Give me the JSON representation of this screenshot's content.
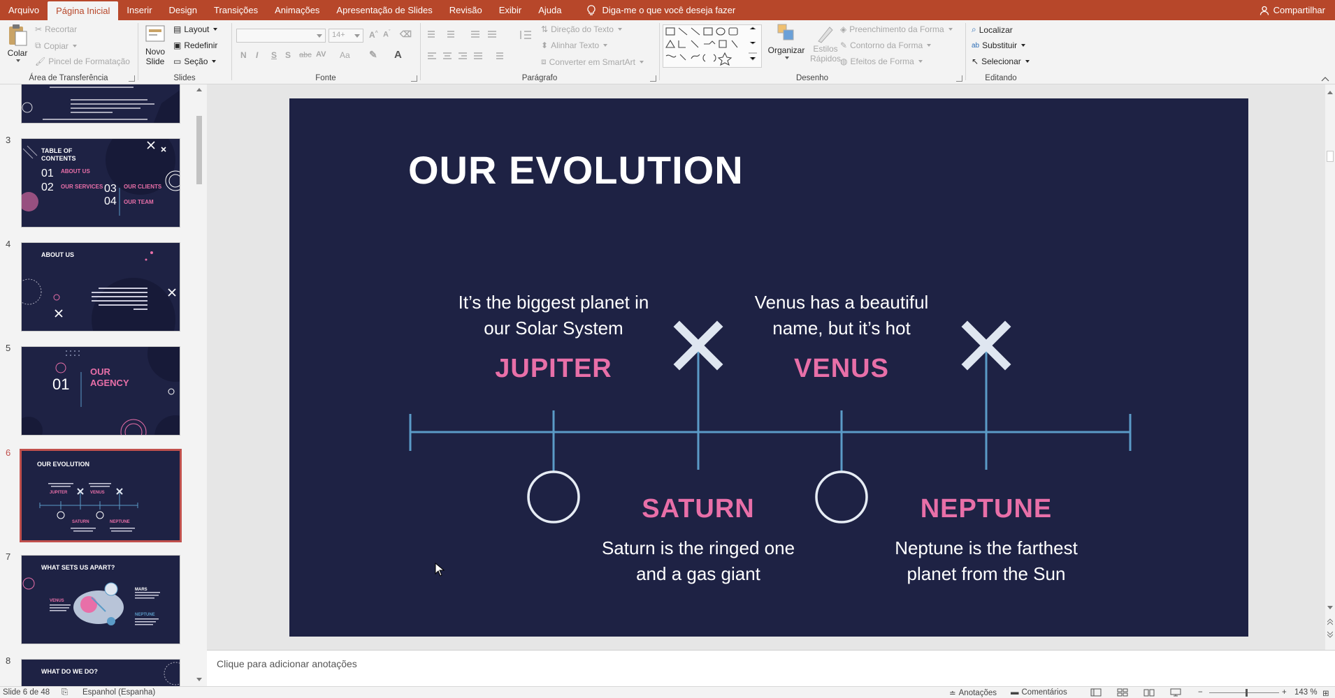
{
  "app": {
    "menu_tabs": [
      "Arquivo",
      "Página Inicial",
      "Inserir",
      "Design",
      "Transições",
      "Animações",
      "Apresentação de Slides",
      "Revisão",
      "Exibir",
      "Ajuda"
    ],
    "active_tab": "Página Inicial",
    "tell_me": "Diga-me o que você deseja fazer",
    "share": "Compartilhar",
    "accent": "#b7472a"
  },
  "ribbon": {
    "clipboard": {
      "paste": "Colar",
      "cut": "Recortar",
      "copy": "Copiar",
      "format_painter": "Pincel de Formatação",
      "label": "Área de Transferência"
    },
    "slides": {
      "new_slide_1": "Novo",
      "new_slide_2": "Slide",
      "layout": "Layout",
      "reset": "Redefinir",
      "section": "Seção",
      "label": "Slides"
    },
    "font": {
      "size": "14+",
      "bold": "N",
      "italic": "I",
      "underline": "S",
      "shadow": "S",
      "strike": "abc",
      "spacing": "AV",
      "case": "Aa",
      "label": "Fonte"
    },
    "paragraph": {
      "direction": "Direção do Texto",
      "align": "Alinhar Texto",
      "smartart": "Converter em SmartArt",
      "label": "Parágrafo"
    },
    "drawing": {
      "arrange": "Organizar",
      "styles_1": "Estilos",
      "styles_2": "Rápidos",
      "fill": "Preenchimento da Forma",
      "outline": "Contorno da Forma",
      "effects": "Efeitos de Forma",
      "label": "Desenho"
    },
    "editing": {
      "find": "Localizar",
      "replace": "Substituir",
      "select": "Selecionar",
      "label": "Editando"
    }
  },
  "thumbnails": {
    "slide3": {
      "num": "3",
      "title_1": "TABLE OF",
      "title_2": "CONTENTS",
      "n1": "01",
      "n2": "02",
      "n3": "03",
      "n4": "04",
      "s1": "ABOUT US",
      "s2": "OUR SERVICES",
      "s3": "OUR CLIENTS",
      "s4": "OUR TEAM"
    },
    "slide4": {
      "num": "4",
      "title": "ABOUT US"
    },
    "slide5": {
      "num": "5",
      "title_1": "OUR",
      "title_2": "AGENCY",
      "n": "01"
    },
    "slide6": {
      "num": "6",
      "title": "OUR EVOLUTION",
      "p1": "JUPITER",
      "p2": "VENUS",
      "p3": "SATURN",
      "p4": "NEPTUNE"
    },
    "slide7": {
      "num": "7",
      "title": "WHAT SETS US APART?",
      "p1": "VENUS",
      "p2": "MARS",
      "p3": "NEPTUNE"
    },
    "slide8": {
      "num": "8",
      "title": "WHAT DO WE DO?"
    }
  },
  "slide": {
    "title": "OUR EVOLUTION",
    "items": [
      {
        "name": "JUPITER",
        "desc_1": "It’s the biggest planet in",
        "desc_2": "our Solar System"
      },
      {
        "name": "VENUS",
        "desc_1": "Venus has a beautiful",
        "desc_2": "name, but it’s hot"
      },
      {
        "name": "SATURN",
        "desc_1": "Saturn is the ringed one",
        "desc_2": "and a gas giant"
      },
      {
        "name": "NEPTUNE",
        "desc_1": "Neptune is the farthest",
        "desc_2": "planet from the Sun"
      }
    ],
    "bg_color": "#1e2244",
    "pink": "#e86fa8",
    "line_color": "#5b9bc7"
  },
  "notes": {
    "placeholder": "Clique para adicionar anotações"
  },
  "status": {
    "slide": "Slide 6 de 48",
    "language": "Espanhol (Espanha)",
    "notes": "Anotações",
    "comments": "Comentários",
    "zoom": "143 %"
  }
}
